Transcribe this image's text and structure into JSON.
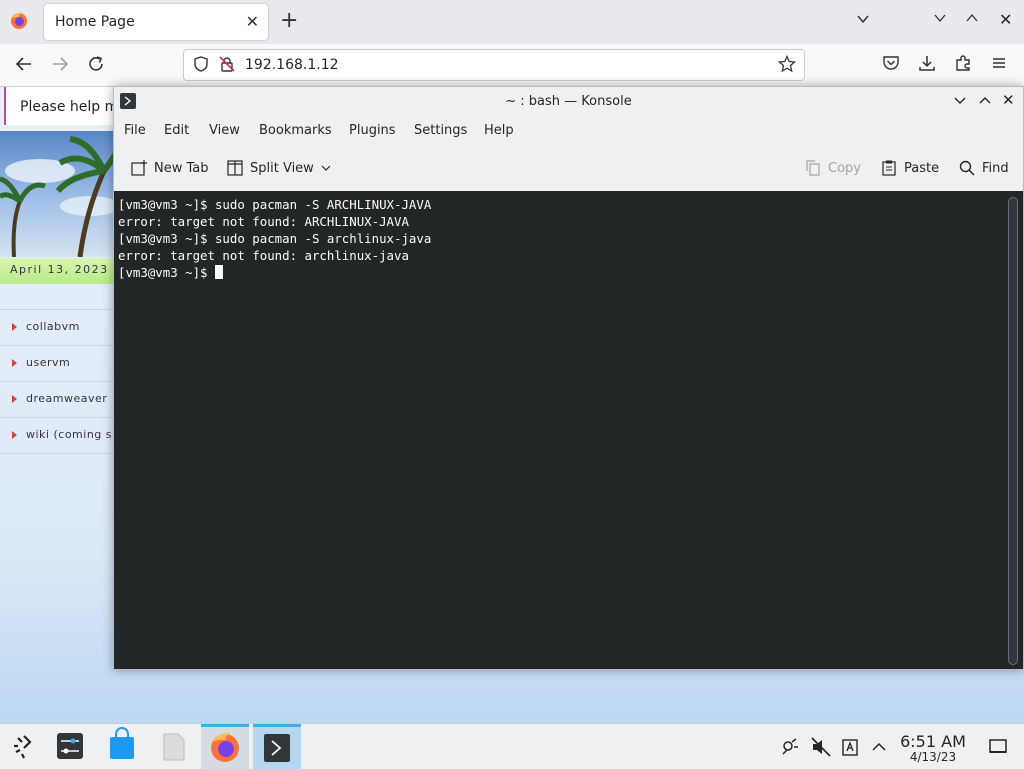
{
  "browser": {
    "tab_title": "Home Page",
    "url": "192.168.1.12"
  },
  "webpage": {
    "notice_text": "Please help ma",
    "date": "April 13, 2023",
    "side_links": [
      "collabvm",
      "uservm",
      "dreamweaver",
      "wiki (coming s"
    ]
  },
  "konsole": {
    "title": "~ : bash — Konsole",
    "menu": [
      "File",
      "Edit",
      "View",
      "Bookmarks",
      "Plugins",
      "Settings",
      "Help"
    ],
    "toolbar": {
      "new_tab": "New Tab",
      "split_view": "Split View",
      "copy": "Copy",
      "paste": "Paste",
      "find": "Find"
    },
    "terminal_lines": [
      "[vm3@vm3 ~]$ sudo pacman -S ARCHLINUX-JAVA",
      "error: target not found: ARCHLINUX-JAVA",
      "[vm3@vm3 ~]$ sudo pacman -S archlinux-java",
      "error: target not found: archlinux-java",
      "[vm3@vm3 ~]$ "
    ]
  },
  "taskbar": {
    "time": "6:51 AM",
    "date": "4/13/23"
  },
  "colors": {
    "accent": "#3daee9",
    "terminal_bg": "#232627",
    "terminal_fg": "#fcfcfc"
  }
}
